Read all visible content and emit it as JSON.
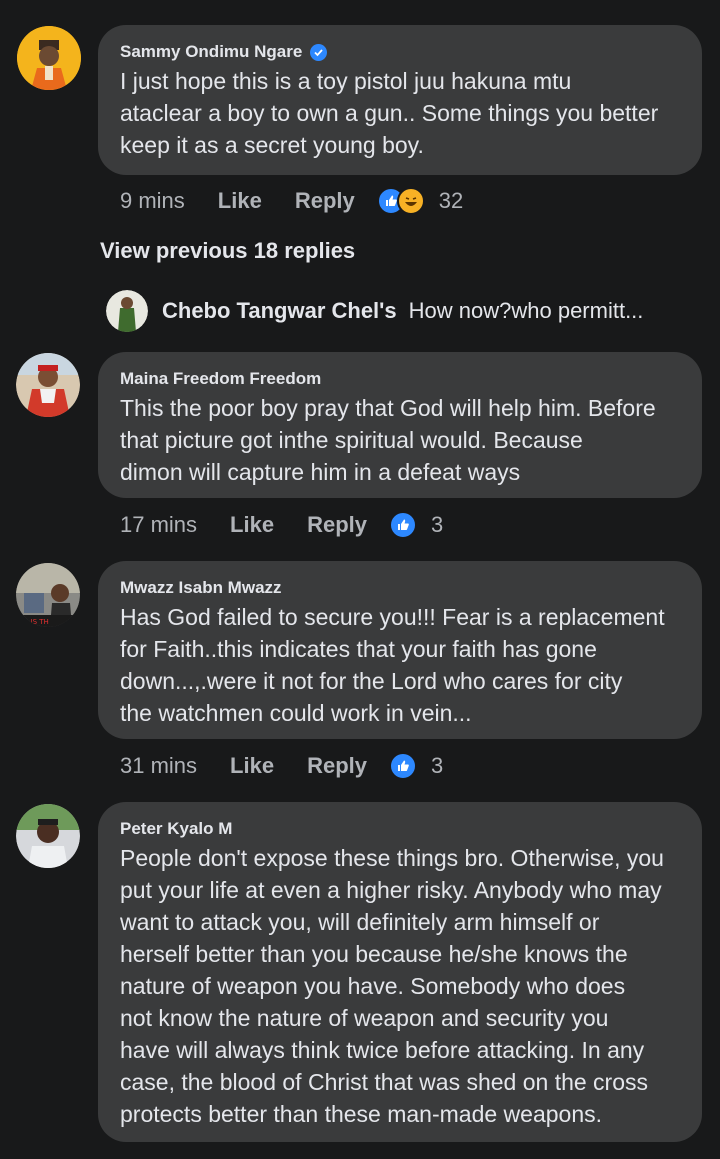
{
  "comments": [
    {
      "name": "Sammy Ondimu Ngare",
      "verified": true,
      "text": "I just hope this is a toy pistol juu hakuna mtu\nataclear a boy to own a gun.. Some things you better\nkeep it as a secret young boy.",
      "time": "9 mins",
      "like_label": "Like",
      "reply_label": "Reply",
      "reactions": [
        "like-icon",
        "haha-icon"
      ],
      "reaction_count": "32"
    },
    {
      "name": "Maina Freedom Freedom",
      "verified": false,
      "text": "This the poor boy pray that God will help him. Before\nthat picture got inthe  spiritual would. Because\ndimon will capture him in a defeat ways",
      "time": "17 mins",
      "like_label": "Like",
      "reply_label": "Reply",
      "reactions": [
        "like-icon"
      ],
      "reaction_count": "3"
    },
    {
      "name": "Mwazz Isabn Mwazz",
      "verified": false,
      "text": "Has God failed to secure you!!! Fear is a replacement\nfor Faith..this indicates that your faith has gone\ndown...,.were it not for the Lord who cares for city\nthe watchmen could work in vein...",
      "time": "31 mins",
      "like_label": "Like",
      "reply_label": "Reply",
      "reactions": [
        "like-icon"
      ],
      "reaction_count": "3"
    },
    {
      "name": "Peter Kyalo M",
      "verified": false,
      "text": "People don't expose these things bro. Otherwise, you\nput your life at even a higher risky. Anybody who may\nwant to attack you, will definitely arm himself or\nherself better than you because he/she knows the\nnature of weapon you have. Somebody who does\nnot know the nature of weapon and security you\nhave will always think twice before attacking. In any\ncase, the blood of Christ that was shed on the cross\nprotects better than these man-made weapons."
    }
  ],
  "view_previous": "View previous 18 replies",
  "reply_preview": {
    "name": "Chebo Tangwar Chel's",
    "text": "How now?who permitt..."
  },
  "avatar_text": {
    "mwazz": "ER IS TH"
  },
  "colors": {
    "background": "#18191a",
    "bubble": "#3a3b3c",
    "text": "#e4e6eb",
    "secondary": "#b0b3b8",
    "like_blue": "#2d88ff",
    "haha_yellow": "#f7b125"
  }
}
